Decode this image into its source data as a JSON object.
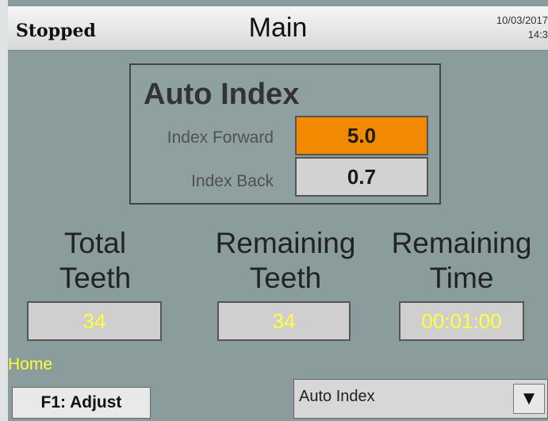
{
  "header": {
    "status": "Stopped",
    "title": "Main",
    "date": "10/03/2017",
    "time": "14:3"
  },
  "auto_index": {
    "title": "Auto Index",
    "index_forward_label": "Index Forward",
    "index_forward_value": "5.0",
    "index_back_label": "Index Back",
    "index_back_value": "0.7"
  },
  "counters": [
    {
      "label_line1": "Total",
      "label_line2": "Teeth",
      "value": "34"
    },
    {
      "label_line1": "Remaining",
      "label_line2": "Teeth",
      "value": "34"
    },
    {
      "label_line1": "Remaining",
      "label_line2": "Time",
      "value": "00:01:00"
    }
  ],
  "footer": {
    "home_label": "Home",
    "f1_label": "F1: Adjust",
    "mode_dropdown_value": "Auto Index",
    "dropdown_arrow": "▼"
  },
  "colors": {
    "background": "#8a9c9c",
    "highlight_field": "#f18a00",
    "value_text": "#ffff3a"
  }
}
